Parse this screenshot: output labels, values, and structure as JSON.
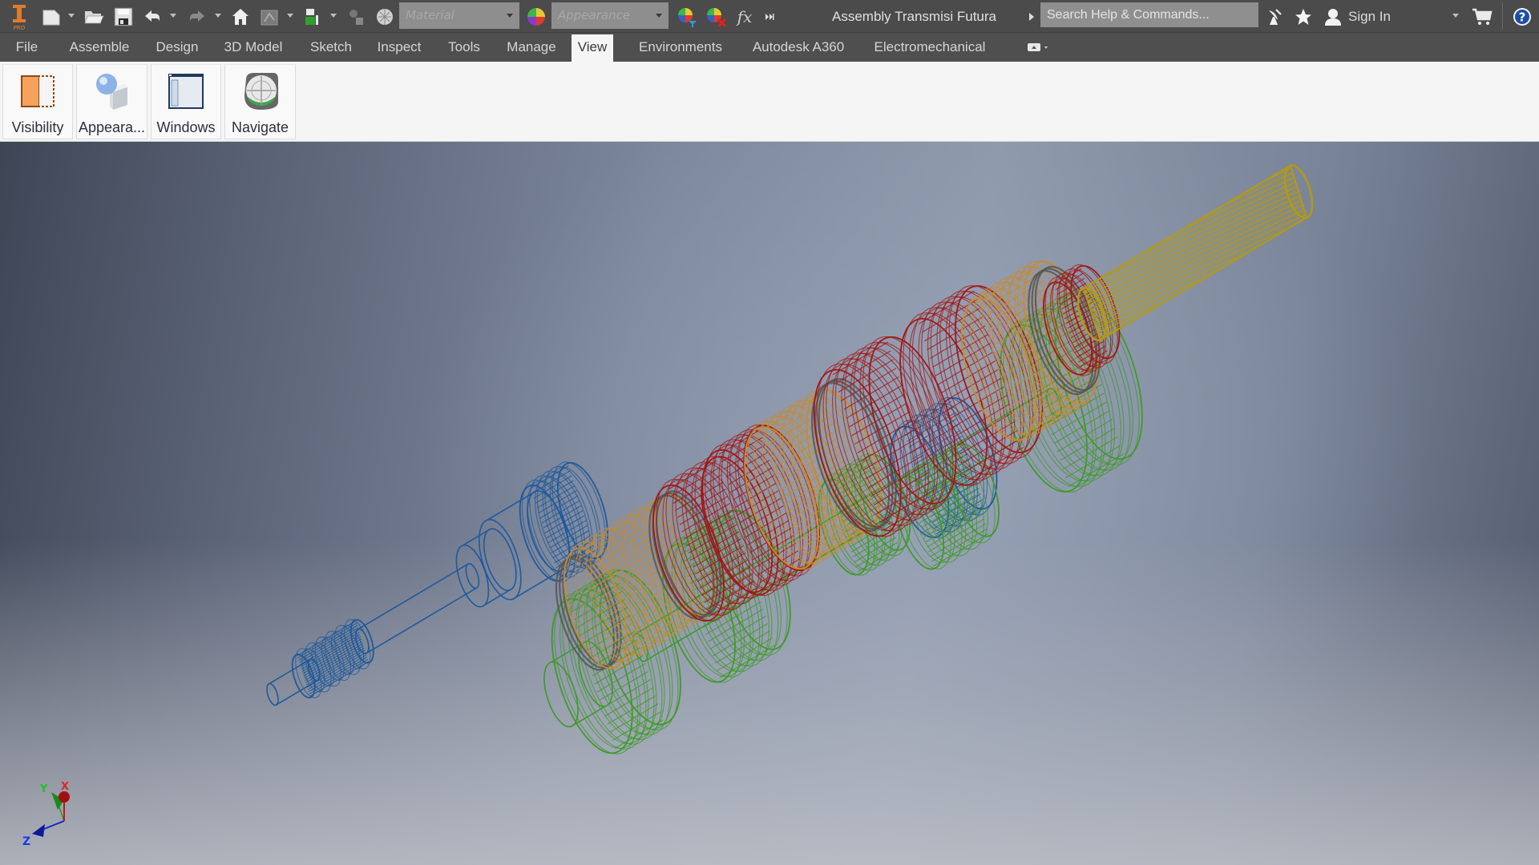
{
  "titlebar": {
    "app_logo": {
      "icon": "inventor-pro-logo",
      "label": "PRO"
    },
    "quick_access": [
      {
        "name": "new",
        "icon": "new-document-icon",
        "has_dropdown": true
      },
      {
        "name": "open",
        "icon": "open-folder-icon",
        "has_dropdown": false
      },
      {
        "name": "save",
        "icon": "save-icon",
        "has_dropdown": false
      },
      {
        "name": "undo",
        "icon": "undo-icon",
        "has_dropdown": true
      },
      {
        "name": "redo",
        "icon": "redo-icon",
        "has_dropdown": true
      },
      {
        "name": "home",
        "icon": "home-icon",
        "has_dropdown": false
      },
      {
        "name": "update",
        "icon": "update-icon",
        "has_dropdown": true
      },
      {
        "name": "select",
        "icon": "select-priority-icon",
        "has_dropdown": true
      },
      {
        "name": "adjust",
        "icon": "adjust-icon",
        "has_dropdown": false
      },
      {
        "name": "material-browser",
        "icon": "material-sphere-icon",
        "has_dropdown": false
      }
    ],
    "material_combo": {
      "placeholder": "Material"
    },
    "appearance_combo": {
      "placeholder": "Appearance"
    },
    "appearance_tools": [
      {
        "name": "adjust-appearance",
        "icon": "appearance-filter-icon"
      },
      {
        "name": "clear-appearance",
        "icon": "appearance-clear-icon"
      },
      {
        "name": "parameters",
        "icon": "fx-icon",
        "label": "fx"
      },
      {
        "name": "more",
        "icon": "overflow-icon"
      }
    ],
    "document_title": "Assembly Transmisi Futura",
    "search": {
      "placeholder": "Search Help & Commands..."
    },
    "right_tools": [
      {
        "name": "subscription",
        "icon": "satellite-icon"
      },
      {
        "name": "favorites",
        "icon": "star-icon"
      }
    ],
    "signin_label": "Sign In",
    "cart_icon": "cart-icon",
    "help_icon": "help-icon",
    "help_label": "?"
  },
  "ribbon": {
    "tabs": [
      {
        "label": "File",
        "state": "file"
      },
      {
        "label": "Assemble",
        "state": ""
      },
      {
        "label": "Design",
        "state": ""
      },
      {
        "label": "3D Model",
        "state": ""
      },
      {
        "label": "Sketch",
        "state": ""
      },
      {
        "label": "Inspect",
        "state": ""
      },
      {
        "label": "Tools",
        "state": ""
      },
      {
        "label": "Manage",
        "state": ""
      },
      {
        "label": "View",
        "state": "active"
      },
      {
        "label": "Environments",
        "state": ""
      },
      {
        "label": "Autodesk A360",
        "state": ""
      },
      {
        "label": "Electromechanical",
        "state": ""
      }
    ],
    "panel_toggle_icon": "panel-display-icon",
    "panels": [
      {
        "label": "Visibility",
        "icon": "visibility-icon"
      },
      {
        "label": "Appeara...",
        "icon": "appearance-icon"
      },
      {
        "label": "Windows",
        "icon": "windows-icon"
      },
      {
        "label": "Navigate",
        "icon": "navigate-icon"
      }
    ]
  },
  "viewport": {
    "model": "transmission gear assembly (wireframe)",
    "colors": {
      "main_shaft": "#1f5a9a",
      "output_shaft": "#b39a12",
      "countershaft": "#3f9a2a",
      "gears_red": "#a01818",
      "synchro_orange": "#c98a2a",
      "bearing_gray": "#555555"
    },
    "triad": {
      "x_label": "X",
      "y_label": "Y",
      "z_label": "Z",
      "x_color": "#c01818",
      "y_color": "#1ea01e",
      "z_color": "#1428c0"
    }
  }
}
